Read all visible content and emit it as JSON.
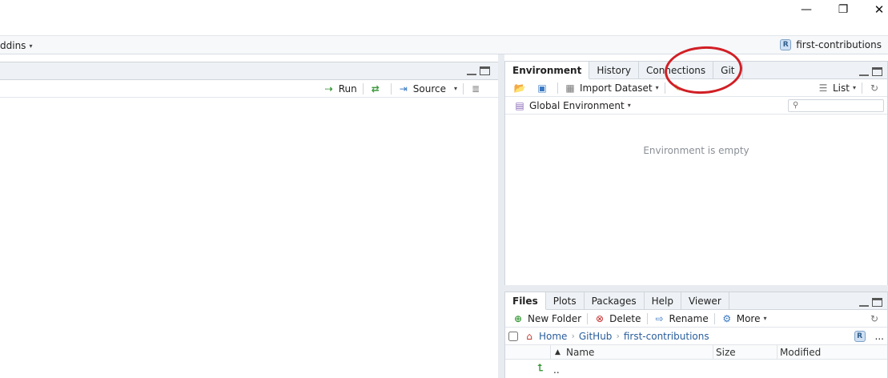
{
  "window": {
    "minimize_glyph": "—",
    "restore_glyph": "❐",
    "close_glyph": "✕"
  },
  "menubar": {
    "addins_label": "ddins",
    "project_name": "first-contributions",
    "project_icon": "R"
  },
  "source": {
    "run_label": "Run",
    "source_label": "Source"
  },
  "env_pane": {
    "tabs": [
      "Environment",
      "History",
      "Connections",
      "Git"
    ],
    "active_tab": "Environment",
    "import_label": "Import Dataset",
    "list_label": "List",
    "scope_label": "Global Environment",
    "empty_text": "Environment is empty",
    "search_placeholder": ""
  },
  "files_pane": {
    "tabs": [
      "Files",
      "Plots",
      "Packages",
      "Help",
      "Viewer"
    ],
    "active_tab": "Files",
    "new_folder_label": "New Folder",
    "delete_label": "Delete",
    "rename_label": "Rename",
    "more_label": "More",
    "breadcrumb": [
      "Home",
      "GitHub",
      "first-contributions"
    ],
    "columns": {
      "name": "Name",
      "size": "Size",
      "modified": "Modified"
    },
    "rows": [
      {
        "name": ".."
      }
    ],
    "overflow": "..."
  },
  "icons": {
    "run": "run-arrow-icon",
    "source": "source-icon",
    "open": "open-folder-icon",
    "save": "save-icon",
    "import": "table-icon",
    "broom": "broom-icon",
    "list": "list-icon",
    "refresh": "refresh-icon",
    "home": "home-icon",
    "up": "up-arrow-icon"
  },
  "colors": {
    "annotation": "#d11f25",
    "link": "#2a5e9c"
  }
}
